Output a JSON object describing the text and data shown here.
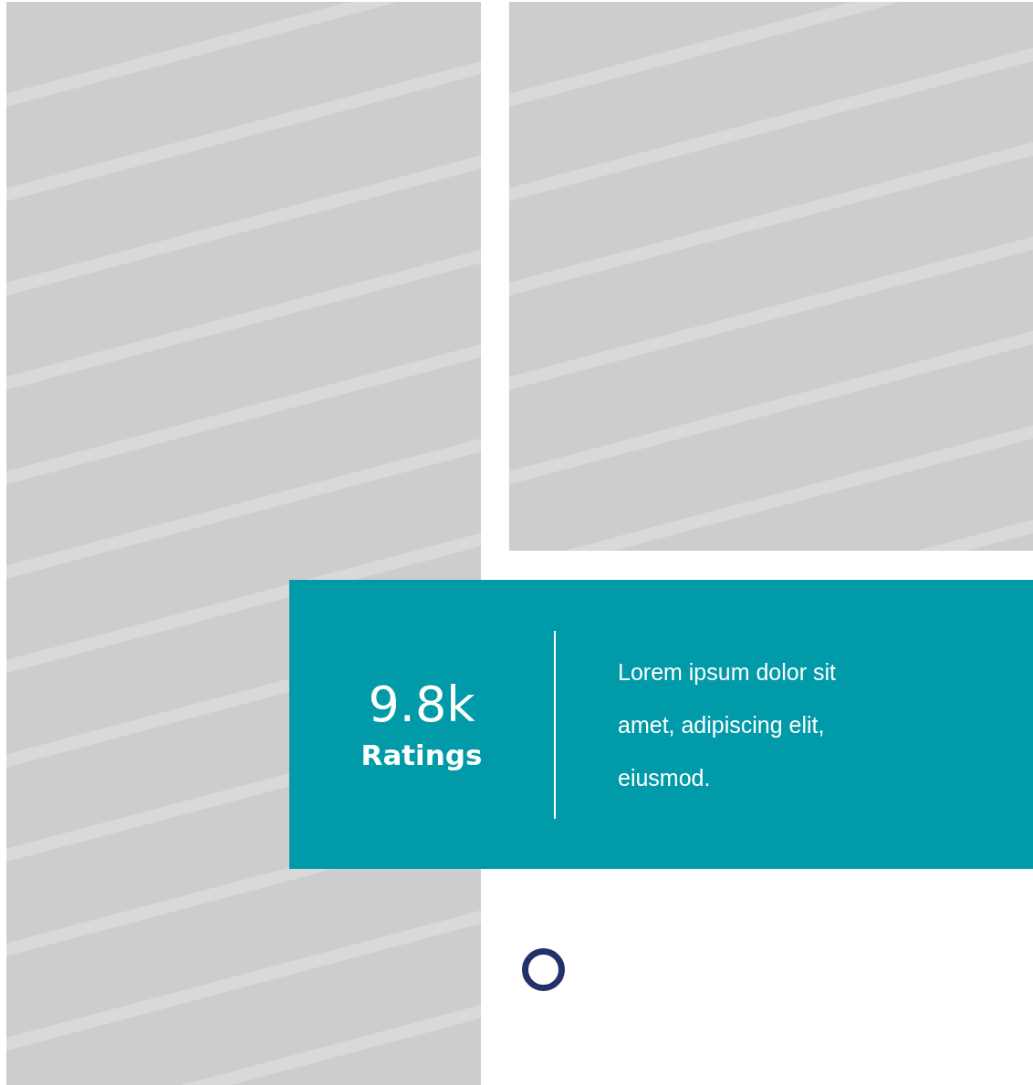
{
  "stat_card": {
    "value": "9.8k",
    "label": "Ratings",
    "description": "Lorem ipsum dolor sit amet, adipiscing elit, eiusmod."
  }
}
